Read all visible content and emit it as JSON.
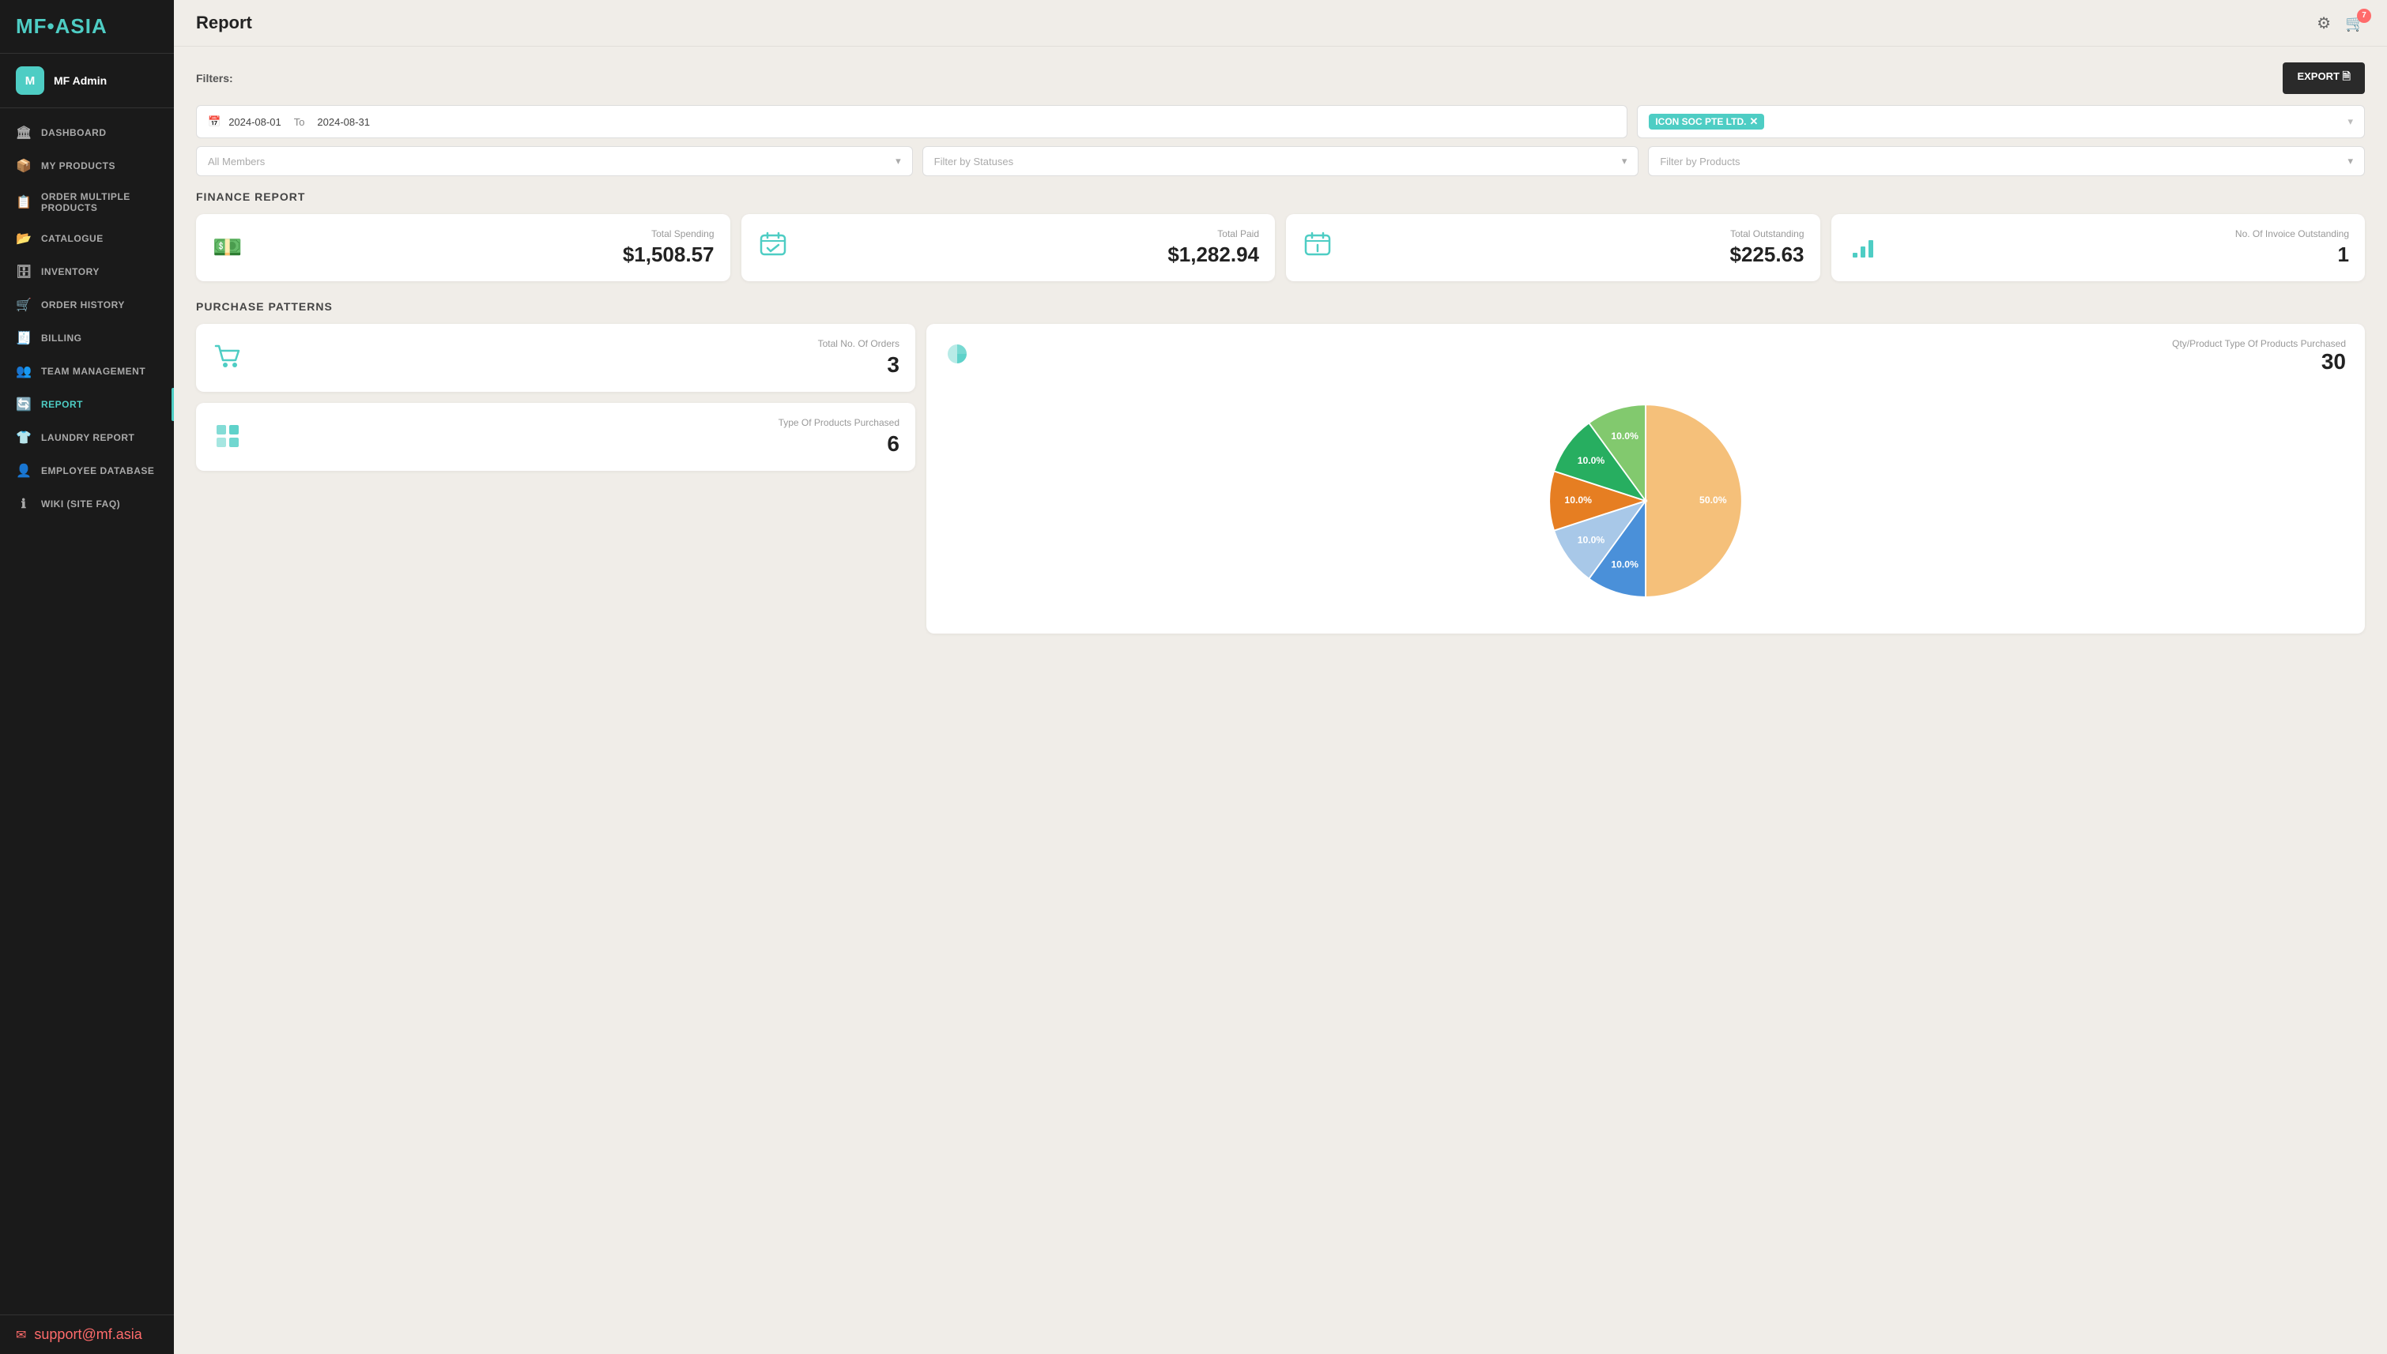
{
  "app": {
    "logo": "MF•ASIA",
    "logo_dot_color": "#4ecdc4"
  },
  "user": {
    "initials": "M",
    "name": "MF Admin"
  },
  "nav": {
    "items": [
      {
        "id": "dashboard",
        "label": "DASHBOARD",
        "icon": "🏛"
      },
      {
        "id": "my-products",
        "label": "MY PRODUCTS",
        "icon": "📦"
      },
      {
        "id": "order-multiple",
        "label": "ORDER MULTIPLE PRODUCTS",
        "icon": "📋"
      },
      {
        "id": "catalogue",
        "label": "CATALOGUE",
        "icon": "📂"
      },
      {
        "id": "inventory",
        "label": "INVENTORY",
        "icon": "🗄"
      },
      {
        "id": "order-history",
        "label": "ORDER HISTORY",
        "icon": "🛒"
      },
      {
        "id": "billing",
        "label": "BILLING",
        "icon": "🧾"
      },
      {
        "id": "team-management",
        "label": "TEAM MANAGEMENT",
        "icon": "👥"
      },
      {
        "id": "report",
        "label": "REPORT",
        "icon": "🔄",
        "active": true
      },
      {
        "id": "laundry-report",
        "label": "LAUNDRY REPORT",
        "icon": "👕"
      },
      {
        "id": "employee-database",
        "label": "EMPLOYEE DATABASE",
        "icon": "👤"
      },
      {
        "id": "wiki",
        "label": "WIKI (SITE FAQ)",
        "icon": "ℹ"
      }
    ]
  },
  "footer": {
    "email": "support@mf.asia"
  },
  "topbar": {
    "title": "Report",
    "cart_count": "7"
  },
  "filters": {
    "label": "Filters:",
    "date_from": "2024-08-01",
    "date_to": "2024-08-31",
    "date_sep": "To",
    "company_tag": "ICON SOC PTE LTD.",
    "members_placeholder": "All Members",
    "statuses_placeholder": "Filter by Statuses",
    "products_placeholder": "Filter by Products",
    "export_label": "EXPORT 🗎"
  },
  "finance": {
    "title": "FINANCE REPORT",
    "cards": [
      {
        "label": "Total Spending",
        "value": "$1,508.57",
        "icon": "💵"
      },
      {
        "label": "Total Paid",
        "value": "$1,282.94",
        "icon": "✅"
      },
      {
        "label": "Total Outstanding",
        "value": "$225.63",
        "icon": "📅"
      },
      {
        "label": "No. Of Invoice Outstanding",
        "value": "1",
        "icon": "📊"
      }
    ]
  },
  "purchase_patterns": {
    "title": "PURCHASE PATTERNS",
    "orders_label": "Total No. Of Orders",
    "orders_value": "3",
    "products_type_label": "Type Of Products Purchased",
    "products_type_value": "6",
    "pie_title": "Qty/Product Type Of Products Purchased",
    "pie_total": "30",
    "pie_icon": "🥧",
    "pie_segments": [
      {
        "label": "50.0%",
        "value": 50,
        "color": "#f5c07a"
      },
      {
        "label": "10.0%",
        "value": 10,
        "color": "#4a90d9"
      },
      {
        "label": "10.0%",
        "value": 10,
        "color": "#a8c8e8"
      },
      {
        "label": "10.0%",
        "value": 10,
        "color": "#e67e22"
      },
      {
        "label": "10.0%",
        "value": 10,
        "color": "#27ae60"
      },
      {
        "label": "10.0%",
        "value": 10,
        "color": "#82c96e"
      }
    ]
  }
}
